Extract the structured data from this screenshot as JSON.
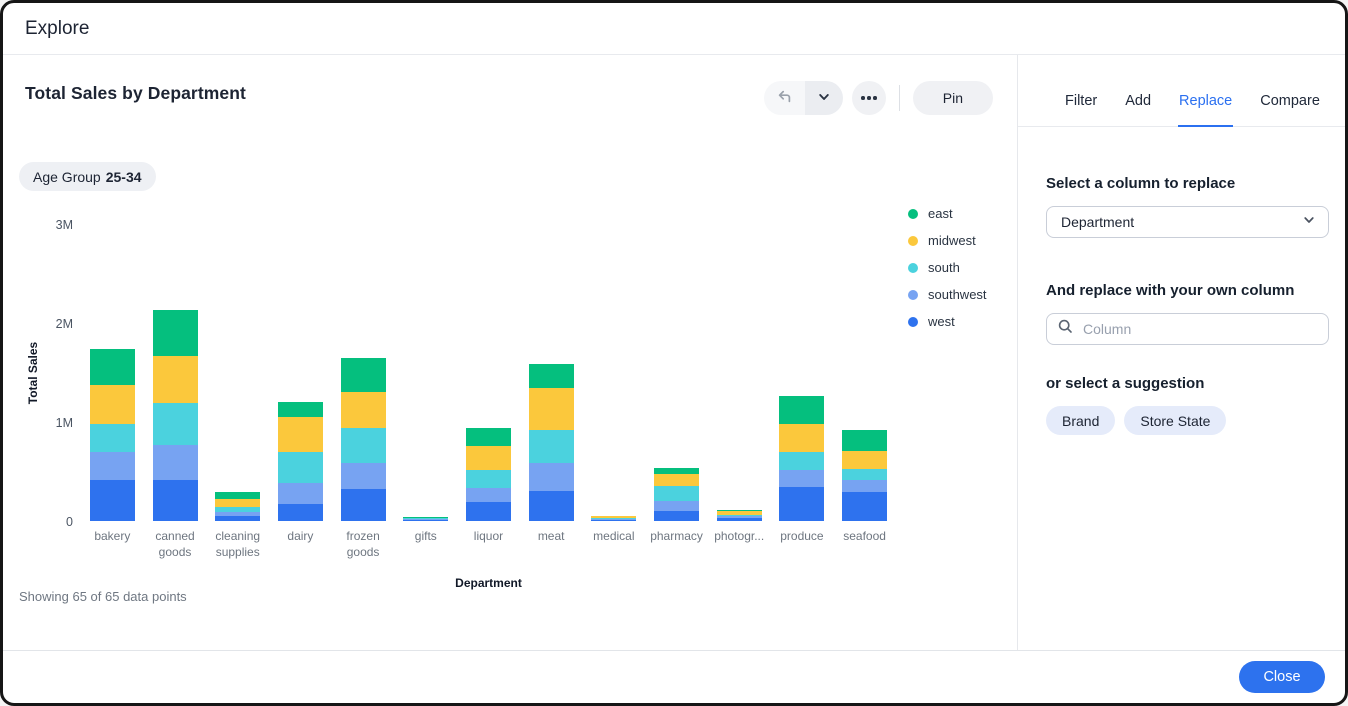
{
  "window": {
    "title": "Explore"
  },
  "chart_panel": {
    "title": "Total Sales by Department",
    "toolbar": {
      "undo_icon": "undo-arrow-icon",
      "dropdown_icon": "chevron-down-icon",
      "more_icon": "ellipsis-icon",
      "pin_label": "Pin"
    },
    "filter_chip": {
      "label": "Age Group",
      "value": "25-34"
    },
    "footnote": "Showing 65 of 65 data points"
  },
  "chart_data": {
    "type": "bar",
    "stacked": true,
    "title": "Total Sales by Department",
    "xlabel": "Department",
    "ylabel": "Total Sales",
    "unit": "millions",
    "ylim": [
      0,
      3
    ],
    "ytick_labels": [
      "0",
      "1M",
      "2M",
      "3M"
    ],
    "grid": false,
    "legend_position": "right",
    "stack_order_bottom_to_top": [
      "west",
      "southwest",
      "south",
      "midwest",
      "east"
    ],
    "categories": [
      "bakery",
      "canned goods",
      "cleaning supplies",
      "dairy",
      "frozen goods",
      "gifts",
      "liquor",
      "meat",
      "medical",
      "pharmacy",
      "photogr...",
      "produce",
      "seafood"
    ],
    "series": [
      {
        "name": "east",
        "color": "#05BF7E",
        "values": [
          0.36,
          0.46,
          0.07,
          0.15,
          0.34,
          0.015,
          0.18,
          0.24,
          0.005,
          0.06,
          0.01,
          0.28,
          0.21
        ]
      },
      {
        "name": "midwest",
        "color": "#FBC83C",
        "values": [
          0.39,
          0.47,
          0.08,
          0.35,
          0.36,
          0.005,
          0.24,
          0.42,
          0.02,
          0.12,
          0.045,
          0.28,
          0.18
        ]
      },
      {
        "name": "south",
        "color": "#4BD2DE",
        "values": [
          0.28,
          0.42,
          0.05,
          0.31,
          0.35,
          0.015,
          0.18,
          0.33,
          0.015,
          0.15,
          0.015,
          0.18,
          0.11
        ]
      },
      {
        "name": "southwest",
        "color": "#77A3F2",
        "values": [
          0.28,
          0.35,
          0.04,
          0.21,
          0.26,
          0.01,
          0.14,
          0.28,
          0.01,
          0.1,
          0.025,
          0.17,
          0.12
        ]
      },
      {
        "name": "west",
        "color": "#2E72EE",
        "values": [
          0.41,
          0.41,
          0.05,
          0.17,
          0.32,
          0.015,
          0.19,
          0.3,
          0.01,
          0.1,
          0.03,
          0.34,
          0.29
        ]
      }
    ]
  },
  "side_panel": {
    "accent_color": "#2B70F0",
    "tabs": [
      {
        "label": "Filter",
        "active": false
      },
      {
        "label": "Add",
        "active": false
      },
      {
        "label": "Replace",
        "active": true
      },
      {
        "label": "Compare",
        "active": false
      }
    ],
    "replace_section": {
      "select_heading": "Select a column to replace",
      "select_value": "Department",
      "select_chevron_icon": "chevron-down-icon",
      "replace_heading": "And replace with your own column",
      "search_icon": "search-icon",
      "search_placeholder": "Column",
      "suggestion_heading": "or select a suggestion",
      "suggestions": [
        "Brand",
        "Store State"
      ]
    }
  },
  "footer": {
    "close_label": "Close"
  }
}
